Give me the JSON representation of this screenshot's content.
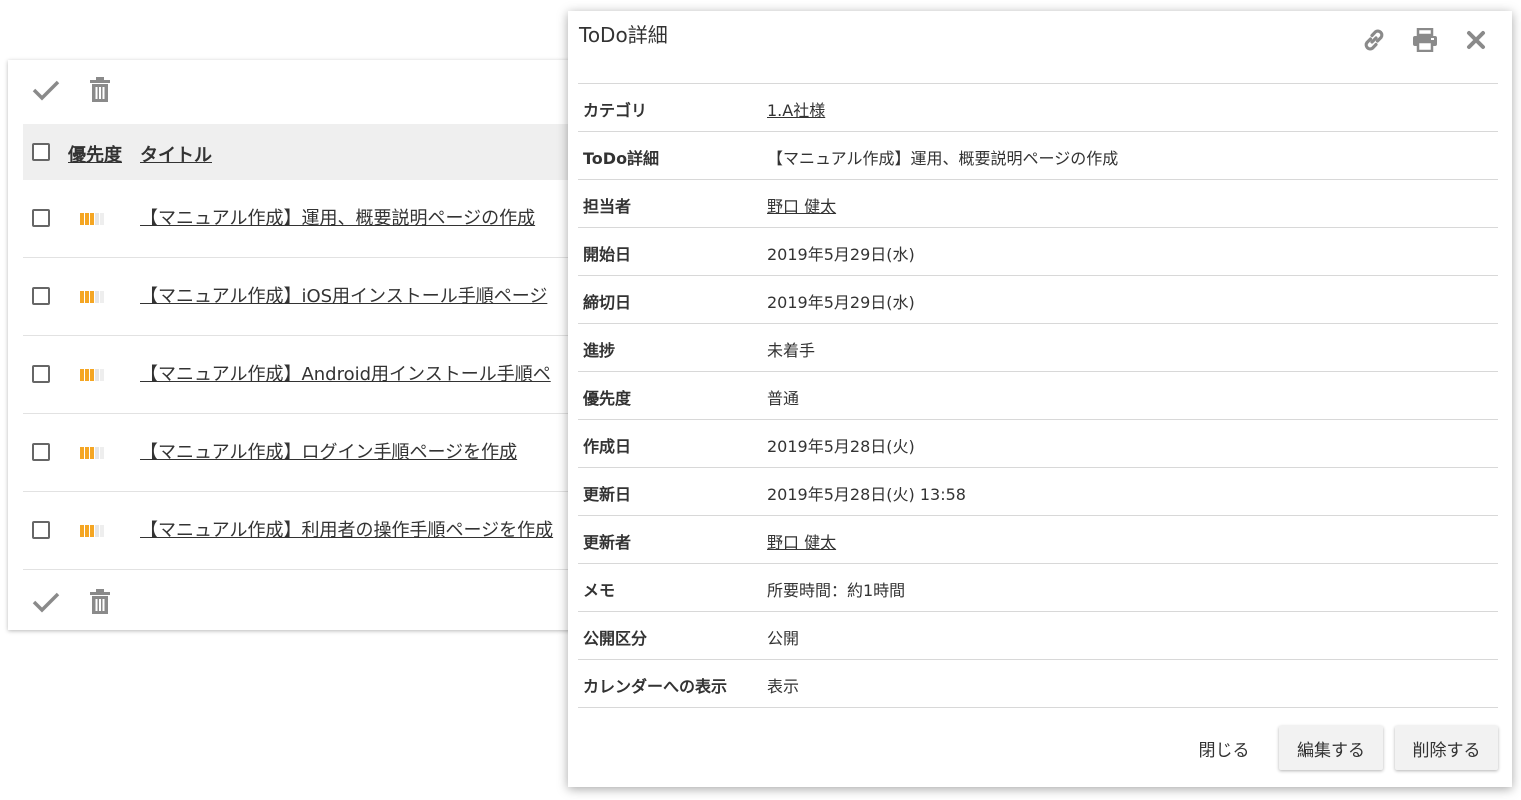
{
  "list": {
    "toolbar": {
      "check_icon": "check-icon",
      "trash_icon": "trash-icon"
    },
    "header": {
      "priority": "優先度",
      "title": "タイトル"
    },
    "rows": [
      {
        "title": "【マニュアル作成】運用、概要説明ページの作成"
      },
      {
        "title": "【マニュアル作成】iOS用インストール手順ページ"
      },
      {
        "title": "【マニュアル作成】Android用インストール手順ペ"
      },
      {
        "title": "【マニュアル作成】ログイン手順ページを作成"
      },
      {
        "title": "【マニュアル作成】利用者の操作手順ページを作成"
      }
    ],
    "priority_colors": [
      "#f5a623",
      "#f5a623",
      "#f5a623",
      "#e6e6e6",
      "#eeeeee"
    ]
  },
  "dialog": {
    "title": "ToDo詳細",
    "icons": [
      "link-icon",
      "print-icon",
      "close-icon"
    ],
    "fields": [
      {
        "label": "カテゴリ",
        "value": "1.A社様"
      },
      {
        "label": "ToDo詳細",
        "value": "【マニュアル作成】運用、概要説明ページの作成"
      },
      {
        "label": "担当者",
        "value": "野口 健太"
      },
      {
        "label": "開始日",
        "value": "2019年5月29日(水)"
      },
      {
        "label": "締切日",
        "value": "2019年5月29日(水)"
      },
      {
        "label": "進捗",
        "value": "未着手"
      },
      {
        "label": "優先度",
        "value": "普通"
      },
      {
        "label": "作成日",
        "value": "2019年5月28日(火)"
      },
      {
        "label": "更新日",
        "value": "2019年5月28日(火) 13:58"
      },
      {
        "label": "更新者",
        "value": "野口 健太"
      },
      {
        "label": "メモ",
        "value": "所要時間：約1時間"
      },
      {
        "label": "公開区分",
        "value": "公開"
      },
      {
        "label": "カレンダーへの表示",
        "value": "表示"
      }
    ],
    "buttons": {
      "close": "閉じる",
      "edit": "編集する",
      "delete": "削除する"
    }
  }
}
